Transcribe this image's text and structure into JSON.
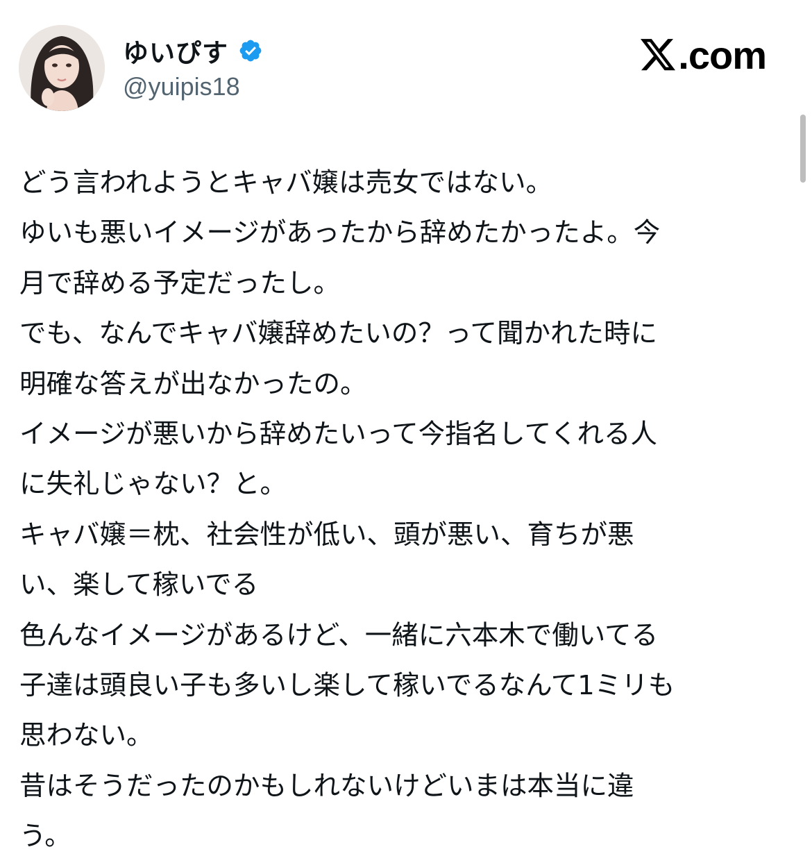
{
  "author": {
    "display_name": "ゆいぴす",
    "handle": "@yuipis18",
    "verified_icon": "verified-badge-icon",
    "avatar_icon": "profile-avatar"
  },
  "brand": {
    "logo_icon": "x-logo-icon",
    "text": ".com"
  },
  "tweet": {
    "lines": [
      "どう言われようとキャバ嬢は売女ではない。",
      "ゆいも悪いイメージがあったから辞めたかったよ。今",
      "月で辞める予定だったし。",
      "でも、なんでキャバ嬢辞めたいの？って聞かれた時に",
      "明確な答えが出なかったの。",
      "イメージが悪いから辞めたいって今指名してくれる人",
      "に失礼じゃない？と。",
      "キャバ嬢＝枕、社会性が低い、頭が悪い、育ちが悪",
      "い、楽して稼いでる",
      "色んなイメージがあるけど、一緒に六本木で働いてる",
      "子達は頭良い子も多いし楽して稼いでるなんて1ミリも",
      "思わない。",
      "昔はそうだったのかもしれないけどいまは本当に違",
      "う。"
    ]
  },
  "colors": {
    "text": "#0f1419",
    "handle": "#536471",
    "verified": "#1d9bf0",
    "background": "#ffffff"
  }
}
